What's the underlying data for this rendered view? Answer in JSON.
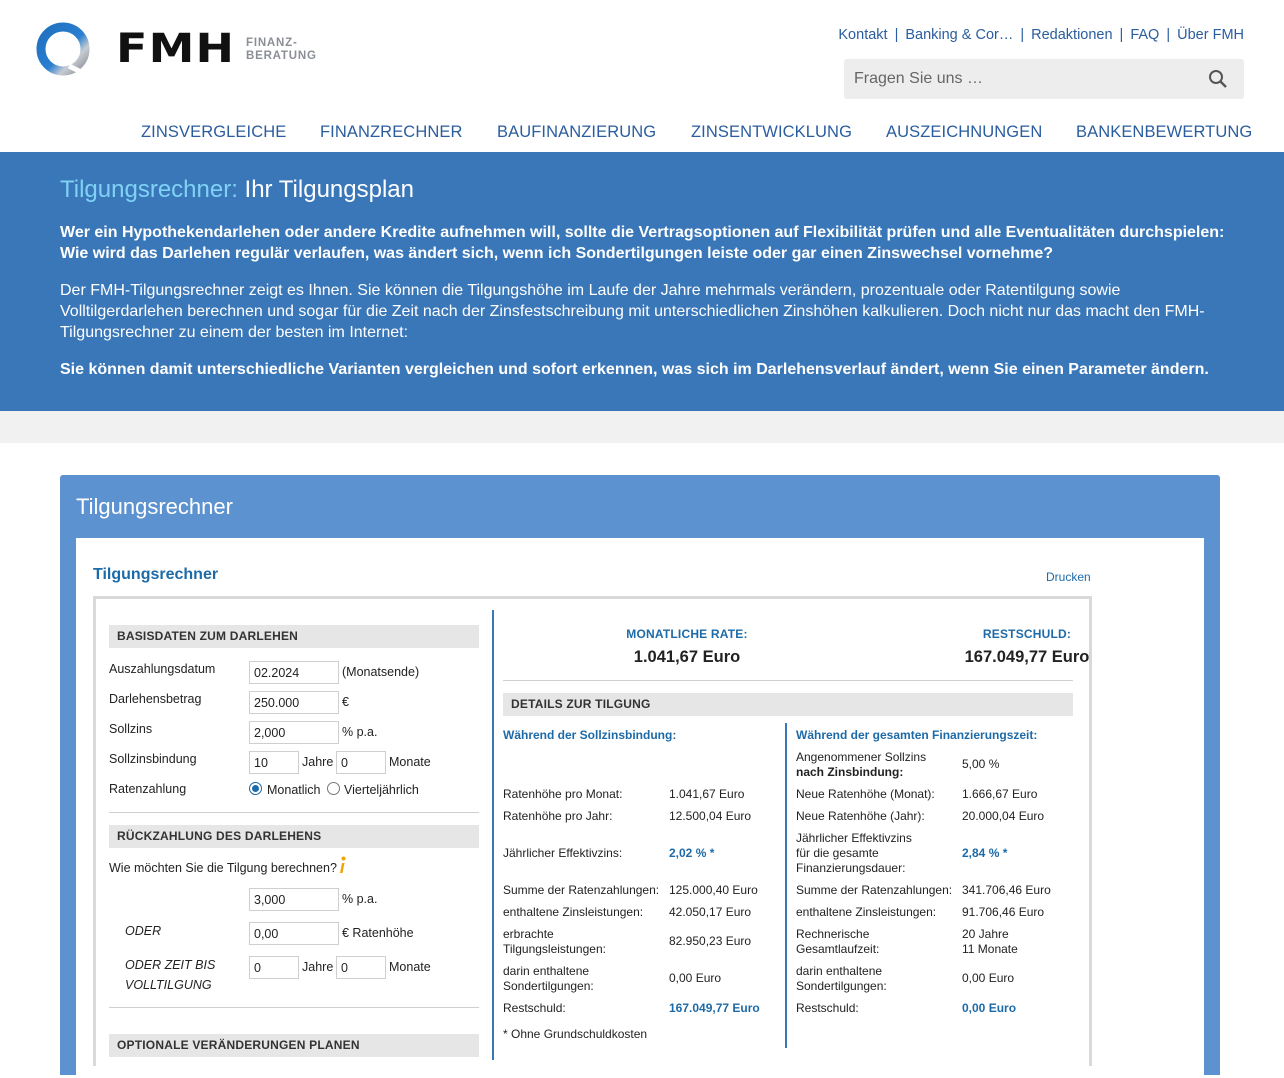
{
  "header": {
    "logo_text": "FMH",
    "logo_sub_1": "FINANZ-",
    "logo_sub_2": "BERATUNG",
    "top_links": [
      "Kontakt",
      "Banking & Cor…",
      "Redaktionen",
      "FAQ",
      "Über FMH"
    ],
    "search_placeholder": "Fragen Sie uns …",
    "nav": [
      "ZINSVERGLEICHE",
      "FINANZRECHNER",
      "BAUFINANZIERUNG",
      "ZINSENTWICKLUNG",
      "AUSZEICHNUNGEN",
      "BANKENBEWERTUNG"
    ]
  },
  "hero": {
    "title_accent": "Tilgungsrechner:",
    "title_rest": " Ihr Tilgungsplan",
    "p1": "Wer ein Hypothekendarlehen oder andere Kredite aufnehmen will, sollte die Vertragsoptionen auf Flexibilität prüfen und alle Eventualitäten durchspielen: Wie wird das Darlehen regulär verlaufen, was ändert sich, wenn ich Sondertilgungen leiste oder gar einen Zinswechsel vornehme?",
    "p2": "Der FMH-Tilgungsrechner zeigt es Ihnen. Sie können die Tilgungshöhe im Laufe der Jahre mehrmals verändern, prozentuale oder Ratentilgung sowie Volltilgerdarlehen berechnen und sogar für die Zeit nach der Zinsfestschreibung mit unterschiedlichen Zinshöhen kalkulieren. Doch nicht nur das macht den FMH-Tilgungsrechner zu einem der besten im Internet:",
    "p3": "Sie können damit unterschiedliche Varianten vergleichen und sofort erkennen, was sich im Darlehensverlauf ändert, wenn Sie einen Parameter ändern."
  },
  "card": {
    "title": "Tilgungsrechner",
    "inner_title": "Tilgungsrechner",
    "print": "Drucken"
  },
  "basis": {
    "heading": "BASISDATEN ZUM DARLEHEN",
    "auszahlung_label": "Auszahlungsdatum",
    "auszahlung_value": "02.2024",
    "auszahlung_unit": "(Monatsende)",
    "betrag_label": "Darlehensbetrag",
    "betrag_value": "250.000",
    "betrag_unit": "€",
    "zins_label": "Sollzins",
    "zins_value": "2,000",
    "zins_unit": "% p.a.",
    "bindung_label": "Sollzinsbindung",
    "bindung_jahre": "10",
    "bindung_jahre_unit": "Jahre",
    "bindung_monate": "0",
    "bindung_monate_unit": "Monate",
    "raten_label": "Ratenzahlung",
    "raten_opt1": "Monatlich",
    "raten_opt2": "Vierteljährlich"
  },
  "rueck": {
    "heading": "RÜCKZAHLUNG DES DARLEHENS",
    "question": "Wie möchten Sie die Tilgung berechnen?",
    "pct_value": "3,000",
    "pct_unit": "% p.a.",
    "oder": "ODER",
    "rate_value": "0,00",
    "rate_unit": "€ Ratenhöhe",
    "oder_zeit_1": "ODER ZEIT BIS",
    "oder_zeit_2": "VOLLTILGUNG",
    "zeit_jahre": "0",
    "zeit_jahre_unit": "Jahre",
    "zeit_monate": "0",
    "zeit_monate_unit": "Monate"
  },
  "optional": {
    "heading": "OPTIONALE VERÄNDERUNGEN PLANEN"
  },
  "results": {
    "rate_label": "MONATLICHE RATE:",
    "rate_value": "1.041,67 Euro",
    "rest_label": "RESTSCHULD:",
    "rest_value": "167.049,77 Euro",
    "details_heading": "DETAILS ZUR TILGUNG",
    "left": {
      "heading": "Während der Sollzinsbindung:",
      "rows": [
        [
          "Ratenhöhe pro Monat:",
          "1.041,67 Euro"
        ],
        [
          "Ratenhöhe pro Jahr:",
          "12.500,04 Euro"
        ],
        [
          "Jährlicher Effektivzins:",
          "2,02 % *"
        ],
        [
          "Summe der Ratenzahlungen:",
          "125.000,40 Euro"
        ],
        [
          "enthaltene Zinsleistungen:",
          "42.050,17 Euro"
        ],
        [
          "erbrachte",
          "Tilgungsleistungen:",
          "82.950,23 Euro"
        ],
        [
          "darin enthaltene",
          "Sondertilgungen:",
          "0,00 Euro"
        ],
        [
          "Restschuld:",
          "167.049,77 Euro"
        ]
      ],
      "footnote": "* Ohne Grundschuldkosten"
    },
    "right": {
      "heading": "Während der gesamten Finanzierungszeit:",
      "zins_l1": "Angenommener Sollzins",
      "zins_l2": "nach Zinsbindung:",
      "zins_v": "5,00 %",
      "neu_monat_l": "Neue Ratenhöhe (Monat):",
      "neu_monat_v": "1.666,67 Euro",
      "neu_jahr_l": "Neue Ratenhöhe (Jahr):",
      "neu_jahr_v": "20.000,04 Euro",
      "eff_l1": "Jährlicher Effektivzins",
      "eff_l2": "für die gesamte",
      "eff_l3": "Finanzierungsdauer:",
      "eff_v": "2,84 % *",
      "summe_l": "Summe der Ratenzahlungen:",
      "summe_v": "341.706,46 Euro",
      "zinsl_l": "enthaltene Zinsleistungen:",
      "zinsl_v": "91.706,46 Euro",
      "lauf_l1": "Rechnerische",
      "lauf_l2": "Gesamtlaufzeit:",
      "lauf_v1": "20 Jahre",
      "lauf_v2": "11 Monate",
      "sonder_l1": "darin enthaltene",
      "sonder_l2": "Sondertilgungen:",
      "sonder_v": "0,00 Euro",
      "rest_l": "Restschuld:",
      "rest_v": "0,00 Euro"
    }
  },
  "colors": {
    "brand_blue": "#3a77b8",
    "accent_cyan": "#7fd2f5",
    "link_blue": "#1d6aa8",
    "card_blue": "#5b92cf"
  }
}
